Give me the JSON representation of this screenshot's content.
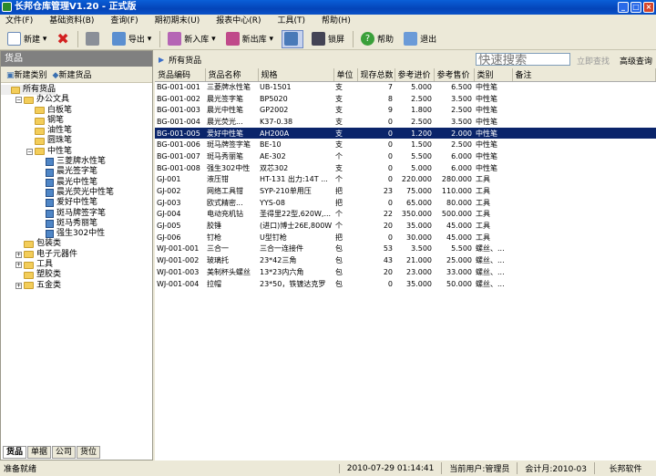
{
  "title": "长邦仓库管理V1.20 - 正式版",
  "menu": [
    "文件(F)",
    "基础资料(B)",
    "查询(F)",
    "期初期末(U)",
    "报表中心(R)",
    "工具(T)",
    "帮助(H)"
  ],
  "toolbar": {
    "new": "新建",
    "export": "导出",
    "new_in": "新入库",
    "new_out": "新出库",
    "lock": "锁屏",
    "help": "帮助",
    "exit": "退出"
  },
  "left": {
    "title": "货品",
    "new_category": "新建类别",
    "new_item": "新建货品",
    "tree": [
      {
        "label": "所有货品",
        "level": 0,
        "type": "root"
      },
      {
        "label": "办公文具",
        "level": 1,
        "type": "folder",
        "pm": "−"
      },
      {
        "label": "白板笔",
        "level": 2,
        "type": "folder"
      },
      {
        "label": "钢笔",
        "level": 2,
        "type": "folder"
      },
      {
        "label": "油性笔",
        "level": 2,
        "type": "folder"
      },
      {
        "label": "圆珠笔",
        "level": 2,
        "type": "folder"
      },
      {
        "label": "中性笔",
        "level": 2,
        "type": "folder",
        "pm": "−"
      },
      {
        "label": "三菱牌水性笔",
        "level": 3,
        "type": "leaf"
      },
      {
        "label": "晨光签字笔",
        "level": 3,
        "type": "leaf"
      },
      {
        "label": "晨光中性笔",
        "level": 3,
        "type": "leaf"
      },
      {
        "label": "晨光荧光中性笔",
        "level": 3,
        "type": "leaf"
      },
      {
        "label": "爱好中性笔",
        "level": 3,
        "type": "leaf"
      },
      {
        "label": "斑马牌签字笔",
        "level": 3,
        "type": "leaf"
      },
      {
        "label": "斑马秀丽笔",
        "level": 3,
        "type": "leaf"
      },
      {
        "label": "强生302中性",
        "level": 3,
        "type": "leaf"
      },
      {
        "label": "包装类",
        "level": 1,
        "type": "folder"
      },
      {
        "label": "电子元器件",
        "level": 1,
        "type": "folder",
        "pm": "+"
      },
      {
        "label": "工具",
        "level": 1,
        "type": "folder",
        "pm": "+"
      },
      {
        "label": "塑胶类",
        "level": 1,
        "type": "folder"
      },
      {
        "label": "五金类",
        "level": 1,
        "type": "folder",
        "pm": "+"
      }
    ],
    "tabs": [
      "货品",
      "单据",
      "公司",
      "货位"
    ]
  },
  "main": {
    "breadcrumb": "所有货品",
    "search_placeholder": "快速搜索",
    "quick_find": "立即查找",
    "advanced": "高级查询",
    "columns": [
      "货品编码",
      "货品名称",
      "规格",
      "单位",
      "现存总数",
      "参考进价",
      "参考售价",
      "类别",
      "备注"
    ],
    "rows": [
      [
        "BG-001-001",
        "三菱牌水性笔",
        "UB-1501",
        "支",
        "7",
        "5.000",
        "6.500",
        "中性笔",
        ""
      ],
      [
        "BG-001-002",
        "晨光签字笔",
        "BP5020",
        "支",
        "8",
        "2.500",
        "3.500",
        "中性笔",
        ""
      ],
      [
        "BG-001-003",
        "晨光中性笔",
        "GP2002",
        "支",
        "9",
        "1.800",
        "2.500",
        "中性笔",
        ""
      ],
      [
        "BG-001-004",
        "晨光荧光...",
        "K37-0.38",
        "支",
        "0",
        "2.500",
        "3.500",
        "中性笔",
        ""
      ],
      [
        "BG-001-005",
        "爱好中性笔",
        "AH200A",
        "支",
        "0",
        "1.200",
        "2.000",
        "中性笔",
        ""
      ],
      [
        "BG-001-006",
        "斑马牌签字笔",
        "BE-10",
        "支",
        "0",
        "1.500",
        "2.500",
        "中性笔",
        ""
      ],
      [
        "BG-001-007",
        "斑马秀丽笔",
        "AE-302",
        "个",
        "0",
        "5.500",
        "6.000",
        "中性笔",
        ""
      ],
      [
        "BG-001-008",
        "强生302中性",
        "双芯302",
        "支",
        "0",
        "5.000",
        "6.000",
        "中性笔",
        ""
      ],
      [
        "GJ-001",
        "液压钳",
        "HT-131 出力:14T ...",
        "个",
        "0",
        "220.000",
        "280.000",
        "工具",
        ""
      ],
      [
        "GJ-002",
        "网络工具钳",
        "SYP-210单用压",
        "把",
        "23",
        "75.000",
        "110.000",
        "工具",
        ""
      ],
      [
        "GJ-003",
        "欧式精密...",
        "YYS-08",
        "把",
        "0",
        "65.000",
        "80.000",
        "工具",
        ""
      ],
      [
        "GJ-004",
        "电动充机钻",
        "圣得里22型,620W,...",
        "个",
        "22",
        "350.000",
        "500.000",
        "工具",
        ""
      ],
      [
        "GJ-005",
        "胶锤",
        "(进口)博士26E,800W",
        "个",
        "20",
        "35.000",
        "45.000",
        "工具",
        ""
      ],
      [
        "GJ-006",
        "钉枪",
        "U型钉枪",
        "把",
        "0",
        "30.000",
        "45.000",
        "工具",
        ""
      ],
      [
        "WJ-001-001",
        "三合一",
        "三合一连接件",
        "包",
        "53",
        "3.500",
        "5.500",
        "螺丝、...",
        ""
      ],
      [
        "WJ-001-002",
        "玻璃托",
        "23*42三角",
        "包",
        "43",
        "21.000",
        "25.000",
        "螺丝、...",
        ""
      ],
      [
        "WJ-001-003",
        "美制杯头螺丝",
        "13*23内六角",
        "包",
        "20",
        "23.000",
        "33.000",
        "螺丝、...",
        ""
      ],
      [
        "WJ-001-004",
        "拉帽",
        "23*50，铁镀达克罗",
        "包",
        "0",
        "35.000",
        "50.000",
        "螺丝、...",
        ""
      ]
    ],
    "selected_row": 4
  },
  "status": {
    "ready": "准备就绪",
    "datetime": "2010-07-29 01:14:41",
    "user": "当前用户:管理员",
    "period": "会计月:2010-03",
    "company": "长邦软件"
  }
}
